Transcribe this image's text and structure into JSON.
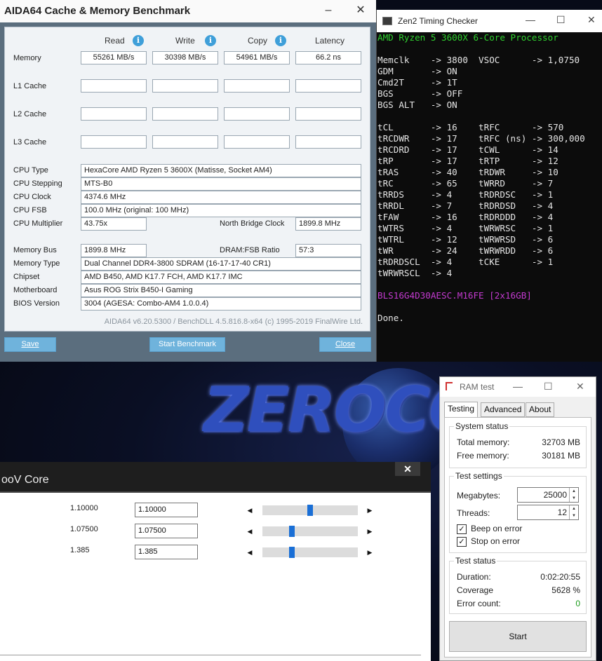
{
  "aida": {
    "title": "AIDA64 Cache & Memory Benchmark",
    "minimize": "–",
    "close": "✕",
    "headers": {
      "read": "Read",
      "write": "Write",
      "copy": "Copy",
      "latency": "Latency"
    },
    "info_glyph": "i",
    "bench_rows": [
      {
        "label": "Memory",
        "read": "55261 MB/s",
        "write": "30398 MB/s",
        "copy": "54961 MB/s",
        "latency": "66.2 ns"
      },
      {
        "label": "L1 Cache",
        "read": "",
        "write": "",
        "copy": "",
        "latency": ""
      },
      {
        "label": "L2 Cache",
        "read": "",
        "write": "",
        "copy": "",
        "latency": ""
      },
      {
        "label": "L3 Cache",
        "read": "",
        "write": "",
        "copy": "",
        "latency": ""
      }
    ],
    "cpu_type_label": "CPU Type",
    "cpu_type": "HexaCore AMD Ryzen 5 3600X  (Matisse, Socket AM4)",
    "cpu_stepping_label": "CPU Stepping",
    "cpu_stepping": "MTS-B0",
    "cpu_clock_label": "CPU Clock",
    "cpu_clock": "4374.6 MHz",
    "cpu_fsb_label": "CPU FSB",
    "cpu_fsb": "100.0 MHz  (original: 100 MHz)",
    "cpu_mult_label": "CPU Multiplier",
    "cpu_mult": "43.75x",
    "nb_clock_label": "North Bridge Clock",
    "nb_clock": "1899.8 MHz",
    "mem_bus_label": "Memory Bus",
    "mem_bus": "1899.8 MHz",
    "dram_fsb_label": "DRAM:FSB Ratio",
    "dram_fsb": "57:3",
    "mem_type_label": "Memory Type",
    "mem_type": "Dual Channel DDR4-3800 SDRAM  (16-17-17-40 CR1)",
    "chipset_label": "Chipset",
    "chipset": "AMD B450, AMD K17.7 FCH, AMD K17.7 IMC",
    "mobo_label": "Motherboard",
    "mobo": "Asus ROG Strix B450-I Gaming",
    "bios_label": "BIOS Version",
    "bios": "3004  (AGESA: Combo-AM4 1.0.0.4)",
    "footer": "AIDA64 v6.20.5300 / BenchDLL 4.5.816.8-x64  (c) 1995-2019 FinalWire Ltd.",
    "save_label": "Save",
    "start_label": "Start Benchmark",
    "close_label": "Close"
  },
  "zen": {
    "title": "Zen2 Timing Checker",
    "minimize": "—",
    "maximize": "☐",
    "close": "✕",
    "processor": "AMD Ryzen 5 3600X 6-Core Processor",
    "block1": "Memclk    -> 3800  VSOC      -> 1,0750\nGDM       -> ON\nCmd2T     -> 1T\nBGS       -> OFF\nBGS ALT   -> ON",
    "block2": "tCL       -> 16    tRFC      -> 570\ntRCDWR    -> 17    tRFC (ns) -> 300,000\ntRCDRD    -> 17    tCWL      -> 14\ntRP       -> 17    tRTP      -> 12\ntRAS      -> 40    tRDWR     -> 10\ntRC       -> 65    tWRRD     -> 7\ntRRDS     -> 4     tRDRDSC   -> 1\ntRRDL     -> 7     tRDRDSD   -> 4\ntFAW      -> 16    tRDRDDD   -> 4\ntWTRS     -> 4     tWRWRSC   -> 1\ntWTRL     -> 12    tWRWRSD   -> 6\ntWR       -> 24    tWRWRDD   -> 6\ntRDRDSCL  -> 4     tCKE      -> 1\ntWRWRSCL  -> 4",
    "part": "BLS16G4D30AESC.M16FE [2x16GB]",
    "done": "Done."
  },
  "background": {
    "logo_text": "ZEROCOO"
  },
  "volt": {
    "title": "ooV Core",
    "close": "✕",
    "rows": [
      {
        "label": "1.10000",
        "value": "1.10000",
        "level": 0.5
      },
      {
        "label": "1.07500",
        "value": "1.07500",
        "level": 0.3
      },
      {
        "label": "1.385",
        "value": "1.385",
        "level": 0.3
      }
    ],
    "left_arrow": "◀",
    "right_arrow": "▶"
  },
  "ram": {
    "title": "RAM test",
    "minimize": "—",
    "maximize": "☐",
    "close": "✕",
    "tabs": [
      "Testing",
      "Advanced",
      "About"
    ],
    "system_status_title": "System status",
    "total_memory_label": "Total memory:",
    "total_memory": "32703 MB",
    "free_memory_label": "Free memory:",
    "free_memory": "30181 MB",
    "test_settings_title": "Test settings",
    "megabytes_label": "Megabytes:",
    "megabytes": "25000",
    "threads_label": "Threads:",
    "threads": "12",
    "spin_glyph": "▲\n▼",
    "beep_label": "Beep on error",
    "stop_label": "Stop on error",
    "check_glyph": "✓",
    "test_status_title": "Test status",
    "duration_label": "Duration:",
    "duration": "0:02:20:55",
    "coverage_label": "Coverage",
    "coverage": "5628 %",
    "error_label": "Error count:",
    "error_count": "0",
    "error_color": "#1a9a1a",
    "start_label": "Start"
  }
}
